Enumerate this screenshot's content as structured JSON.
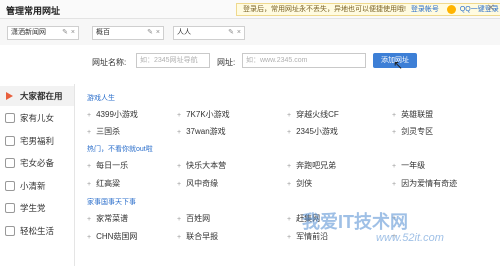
{
  "header": {
    "title": "管理常用网址",
    "notice": "登录后，常用网址永不丢失，异地也可以便捷使用哦!",
    "login_link": "登录帐号",
    "qq_login": "QQ一键登录"
  },
  "edit_fields": [
    "潇洒新闻网",
    "概百",
    "人人"
  ],
  "add_form": {
    "name_label": "网址名称:",
    "name_placeholder": "如：2345网址导航",
    "url_label": "网址:",
    "url_placeholder": "如：www.2345.com",
    "add_button": "添加网址"
  },
  "sidebar": {
    "items": [
      {
        "label": "大家都在用",
        "icon": "arrow-right-icon"
      },
      {
        "label": "家有儿女",
        "icon": "family-icon"
      },
      {
        "label": "宅男福利",
        "icon": "gift-icon"
      },
      {
        "label": "宅女必备",
        "icon": "heart-icon"
      },
      {
        "label": "小清新",
        "icon": "leaf-icon"
      },
      {
        "label": "学生党",
        "icon": "book-icon"
      },
      {
        "label": "轻松生活",
        "icon": "home-icon"
      }
    ]
  },
  "sections": [
    {
      "title": "游戏人生",
      "links": [
        "4399小游戏",
        "7K7K小游戏",
        "穿越火线CF",
        "英雄联盟",
        "三国杀",
        "37wan游戏",
        "2345小游戏",
        "剑灵专区"
      ]
    },
    {
      "title": "热门，不看你就out啦",
      "links": [
        "每日一乐",
        "快乐大本营",
        "奔跑吧兄弟",
        "一年级",
        "红高粱",
        "风中奇缘",
        "剑侠",
        "因为爱情有奇迹"
      ]
    },
    {
      "title": "家事国事天下事",
      "links": [
        "家常菜谱",
        "百姓网",
        "赶集网",
        "",
        "CHN菇国网",
        "联合早报",
        "军情前沿",
        ""
      ]
    }
  ],
  "watermark": {
    "main": "我爱IT技术网",
    "sub": "www.52it.com"
  }
}
